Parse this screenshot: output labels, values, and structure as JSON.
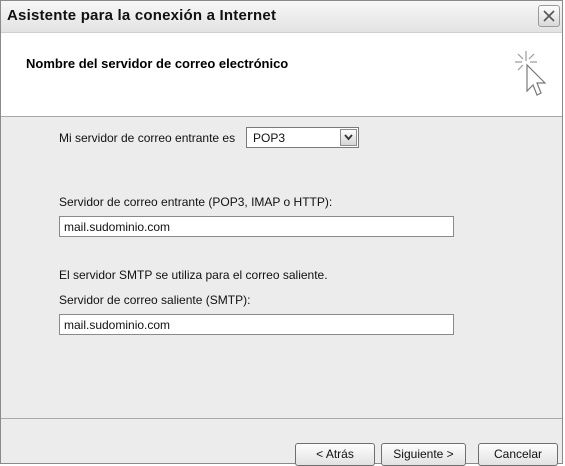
{
  "window": {
    "title": "Asistente para la conexión a Internet"
  },
  "header": {
    "heading": "Nombre del servidor de correo electrónico"
  },
  "form": {
    "incoming_type_label": "Mi servidor de correo entrante es",
    "incoming_type_value": "POP3",
    "incoming_server_label": "Servidor de correo entrante (POP3, IMAP o HTTP):",
    "incoming_server_value": "mail.sudominio.com",
    "smtp_note": "El servidor SMTP se utiliza para el correo saliente.",
    "outgoing_server_label": "Servidor de correo saliente (SMTP):",
    "outgoing_server_value": "mail.sudominio.com"
  },
  "buttons": {
    "back": "< Atrás",
    "next": "Siguiente >",
    "cancel": "Cancelar"
  },
  "icons": {
    "close": "close-icon",
    "wizard": "cursor-sparkle-icon",
    "dropdown": "chevron-down-icon"
  }
}
